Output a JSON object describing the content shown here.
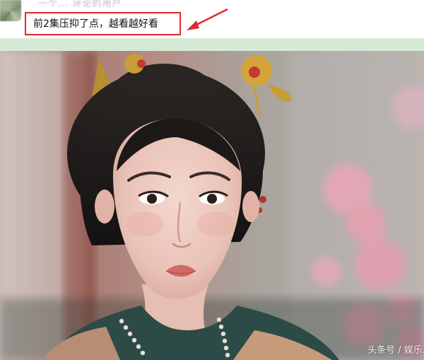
{
  "post": {
    "username": "一个... 评论的用户",
    "comment": "前2集压抑了点，越看越好看"
  },
  "photo": {
    "watermark": "头条号 / 娱乐..."
  },
  "colors": {
    "highlight_border": "#e0282f",
    "band": "#d6ead6",
    "arrow": "#e0282f"
  },
  "icons": {
    "avatar": "blurred-avatar",
    "arrow": "arrow-pointing-left-icon"
  }
}
